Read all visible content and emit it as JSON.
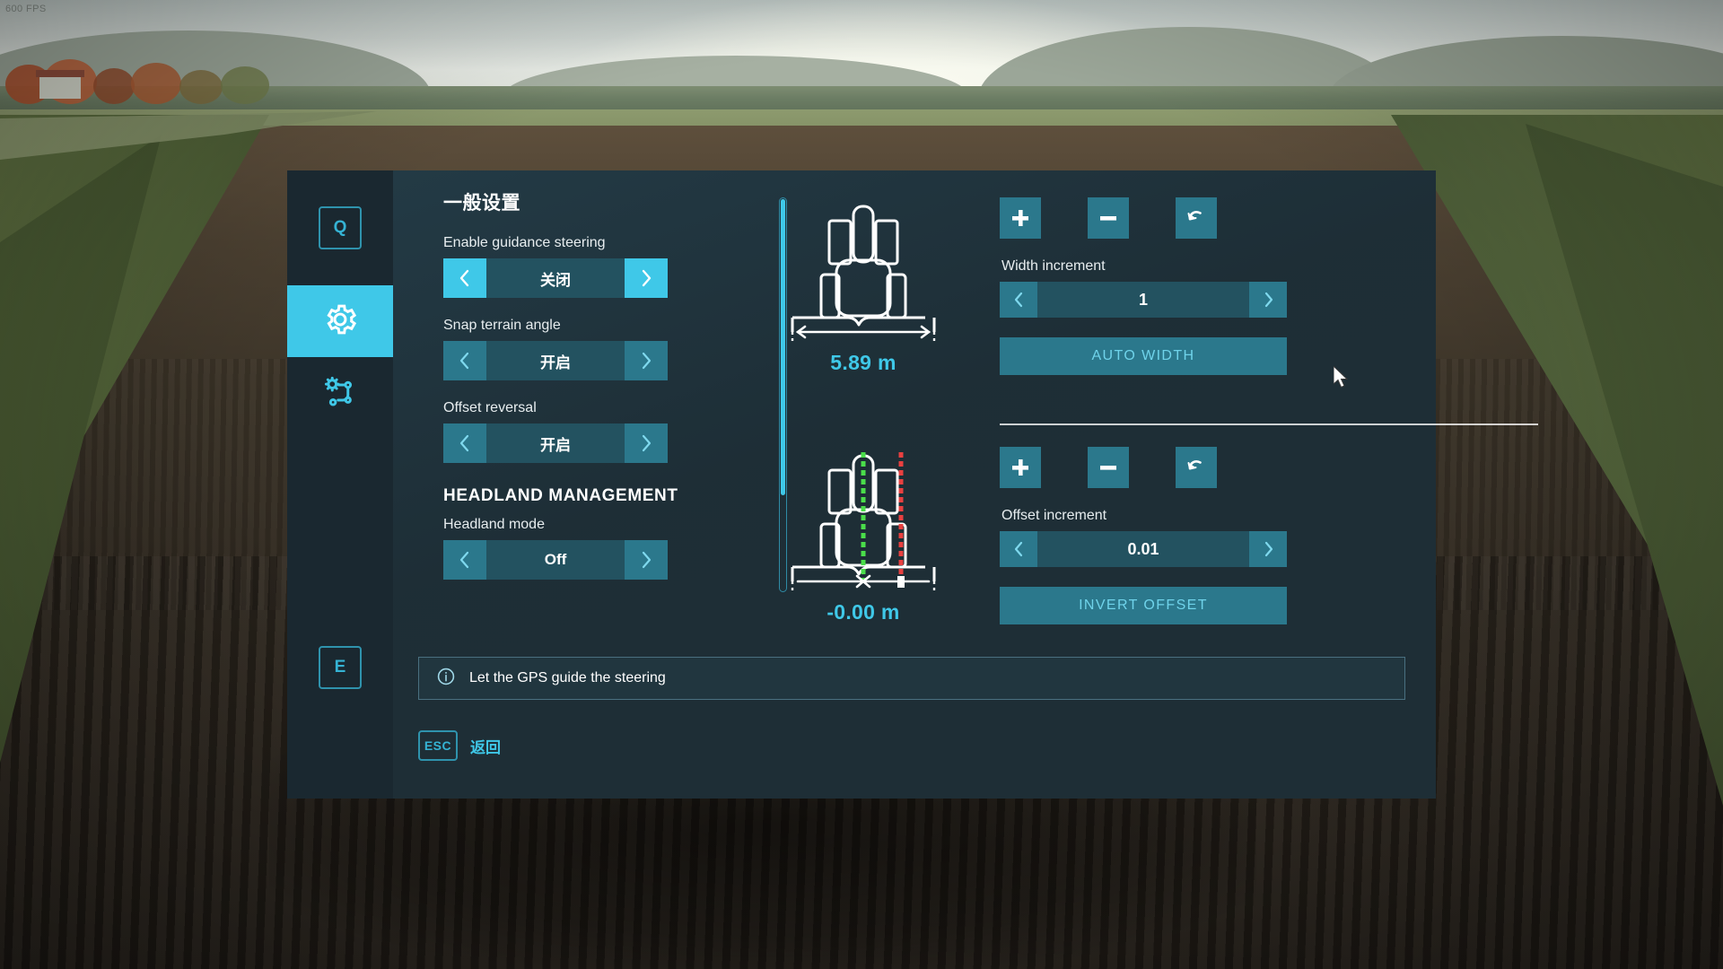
{
  "hud": {
    "fps": "600 FPS"
  },
  "sidebar": {
    "top_key": "Q",
    "bottom_key": "E",
    "tabs": [
      {
        "name": "settings-tab",
        "icon": "gear-icon",
        "active": true
      },
      {
        "name": "track-config-tab",
        "icon": "gear-route-icon",
        "active": false
      }
    ]
  },
  "settings": {
    "heading": "一般设置",
    "rows": [
      {
        "label": "Enable guidance steering",
        "value": "关闭",
        "focused": true
      },
      {
        "label": "Snap terrain angle",
        "value": "开启",
        "focused": false
      },
      {
        "label": "Offset reversal",
        "value": "开启",
        "focused": false
      }
    ],
    "headland_heading": "HEADLAND MANAGEMENT",
    "headland_rows": [
      {
        "label": "Headland mode",
        "value": "Off",
        "focused": false
      }
    ]
  },
  "width_block": {
    "reading": "5.89 m",
    "increment_label": "Width increment",
    "increment_value": "1",
    "action_label": "AUTO WIDTH",
    "buttons": {
      "plus": "+",
      "minus": "−",
      "reset": "reset-icon"
    }
  },
  "offset_block": {
    "reading": "-0.00 m",
    "increment_label": "Offset increment",
    "increment_value": "0.01",
    "action_label": "INVERT OFFSET",
    "buttons": {
      "plus": "+",
      "minus": "−",
      "reset": "reset-icon"
    }
  },
  "info": {
    "icon": "info-icon",
    "text": "Let the GPS guide the steering"
  },
  "footer": {
    "esc_key": "ESC",
    "esc_label": "返回"
  },
  "colors": {
    "accent_cyan": "#3fc8e8",
    "button_teal": "#2b788c",
    "field_teal": "#235260",
    "panel_bg": "#1e2e36",
    "sidebar_bg": "#1a2830",
    "guide_green": "#4ade4a",
    "guide_red": "#e84040"
  }
}
